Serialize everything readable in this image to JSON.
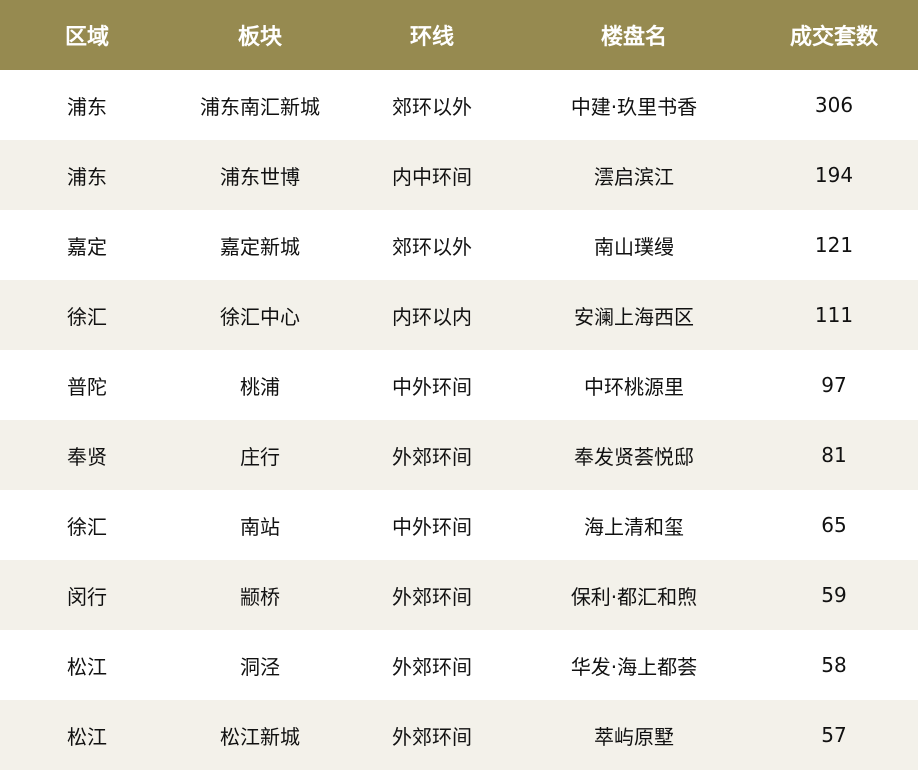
{
  "table": {
    "headers": [
      "区域",
      "板块",
      "环线",
      "楼盘名",
      "成交套数"
    ],
    "rows": [
      [
        "浦东",
        "浦东南汇新城",
        "郊环以外",
        "中建·玖里书香",
        "306"
      ],
      [
        "浦东",
        "浦东世博",
        "内中环间",
        "澐启滨江",
        "194"
      ],
      [
        "嘉定",
        "嘉定新城",
        "郊环以外",
        "南山璞缦",
        "121"
      ],
      [
        "徐汇",
        "徐汇中心",
        "内环以内",
        "安澜上海西区",
        "111"
      ],
      [
        "普陀",
        "桃浦",
        "中外环间",
        "中环桃源里",
        "97"
      ],
      [
        "奉贤",
        "庄行",
        "外郊环间",
        "奉发贤荟悦邸",
        "81"
      ],
      [
        "徐汇",
        "南站",
        "中外环间",
        "海上清和玺",
        "65"
      ],
      [
        "闵行",
        "颛桥",
        "外郊环间",
        "保利·都汇和煦",
        "59"
      ],
      [
        "松江",
        "洞泾",
        "外郊环间",
        "华发·海上都荟",
        "58"
      ],
      [
        "松江",
        "松江新城",
        "外郊环间",
        "萃屿原墅",
        "57"
      ]
    ]
  },
  "colors": {
    "header_bg": "#968a50",
    "header_text": "#ffffff",
    "row_alt_bg": "#f3f1ea",
    "row_bg": "#ffffff",
    "text": "#111111"
  }
}
